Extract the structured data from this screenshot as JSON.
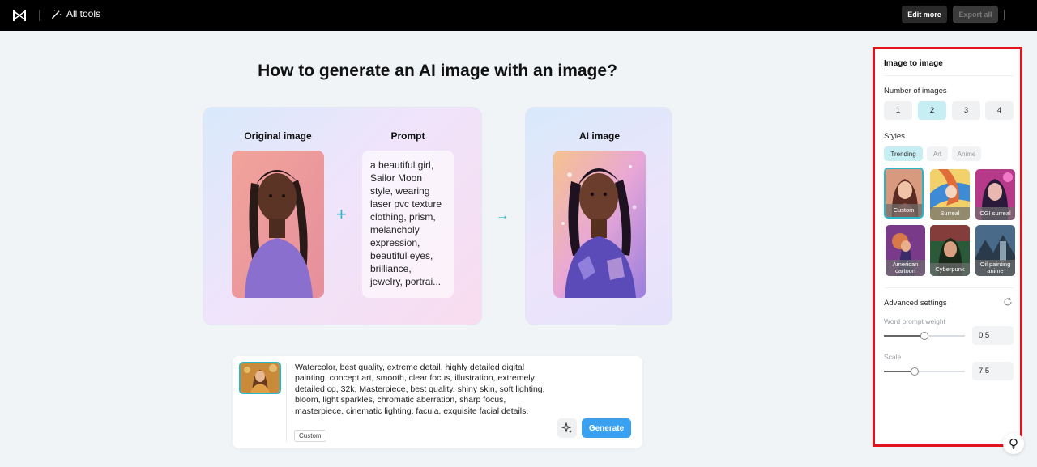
{
  "topbar": {
    "all_tools": "All tools",
    "edit_more": "Edit more",
    "export_all": "Export all"
  },
  "main": {
    "heading": "How to generate an AI image with an image?",
    "original_label": "Original image",
    "prompt_label": "Prompt",
    "prompt_text": "a beautiful girl, Sailor Moon style, wearing laser pvc texture clothing, prism, melancholy expression, beautiful eyes, brilliance, jewelry, portrai...",
    "ai_label": "AI image"
  },
  "composer": {
    "text": "Watercolor, best quality, extreme detail, highly detailed digital painting, concept art, smooth, clear focus, illustration, extremely detailed cg, 32k, Masterpiece, best quality, shiny skin, soft lighting, bloom, light sparkles, chromatic aberration, sharp focus, masterpiece, cinematic lighting, facula, exquisite facial details.",
    "tag": "Custom",
    "generate": "Generate"
  },
  "panel": {
    "title": "Image to image",
    "number_label": "Number of images",
    "numbers": [
      "1",
      "2",
      "3",
      "4"
    ],
    "selected_number": "2",
    "styles_label": "Styles",
    "style_tabs": [
      "Trending",
      "Art",
      "Anime"
    ],
    "styles": [
      "Custom",
      "Surreal",
      "CGI surreal",
      "American cartoon",
      "Cyberpunk",
      "Oil painting anime"
    ],
    "advanced_label": "Advanced settings",
    "word_weight_label": "Word prompt weight",
    "word_weight_value": "0.5",
    "word_weight_fraction": 0.5,
    "scale_label": "Scale",
    "scale_value": "7.5",
    "scale_fraction": 0.38
  },
  "colors": {
    "accent": "#2bb5c9",
    "generate": "#3aa0f0",
    "highlight_border": "#e0141a"
  }
}
